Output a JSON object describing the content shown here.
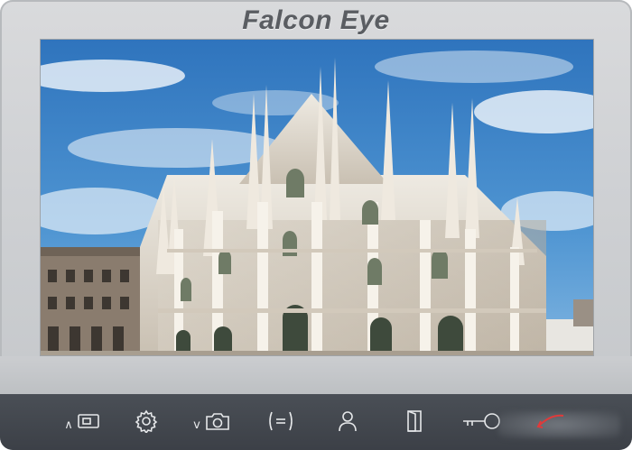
{
  "brand": {
    "name": "Falcon Eye"
  },
  "screen": {
    "scene": "cathedral-camera-feed"
  },
  "controls": [
    {
      "id": "monitor",
      "icon": "monitor-up-icon",
      "arrow": "∧"
    },
    {
      "id": "settings",
      "icon": "gear-icon"
    },
    {
      "id": "snapshot",
      "icon": "camera-down-icon",
      "arrow": "v"
    },
    {
      "id": "intercom",
      "icon": "intercom-icon"
    },
    {
      "id": "user",
      "icon": "user-icon"
    },
    {
      "id": "door",
      "icon": "door-icon"
    },
    {
      "id": "unlock",
      "icon": "key-icon"
    },
    {
      "id": "hangup",
      "icon": "phone-hangup-icon"
    }
  ],
  "colors": {
    "bezel": "#cfd1d4",
    "panel": "#41464d",
    "icon": "#e6e8ea",
    "accent": "#e03a3a"
  }
}
